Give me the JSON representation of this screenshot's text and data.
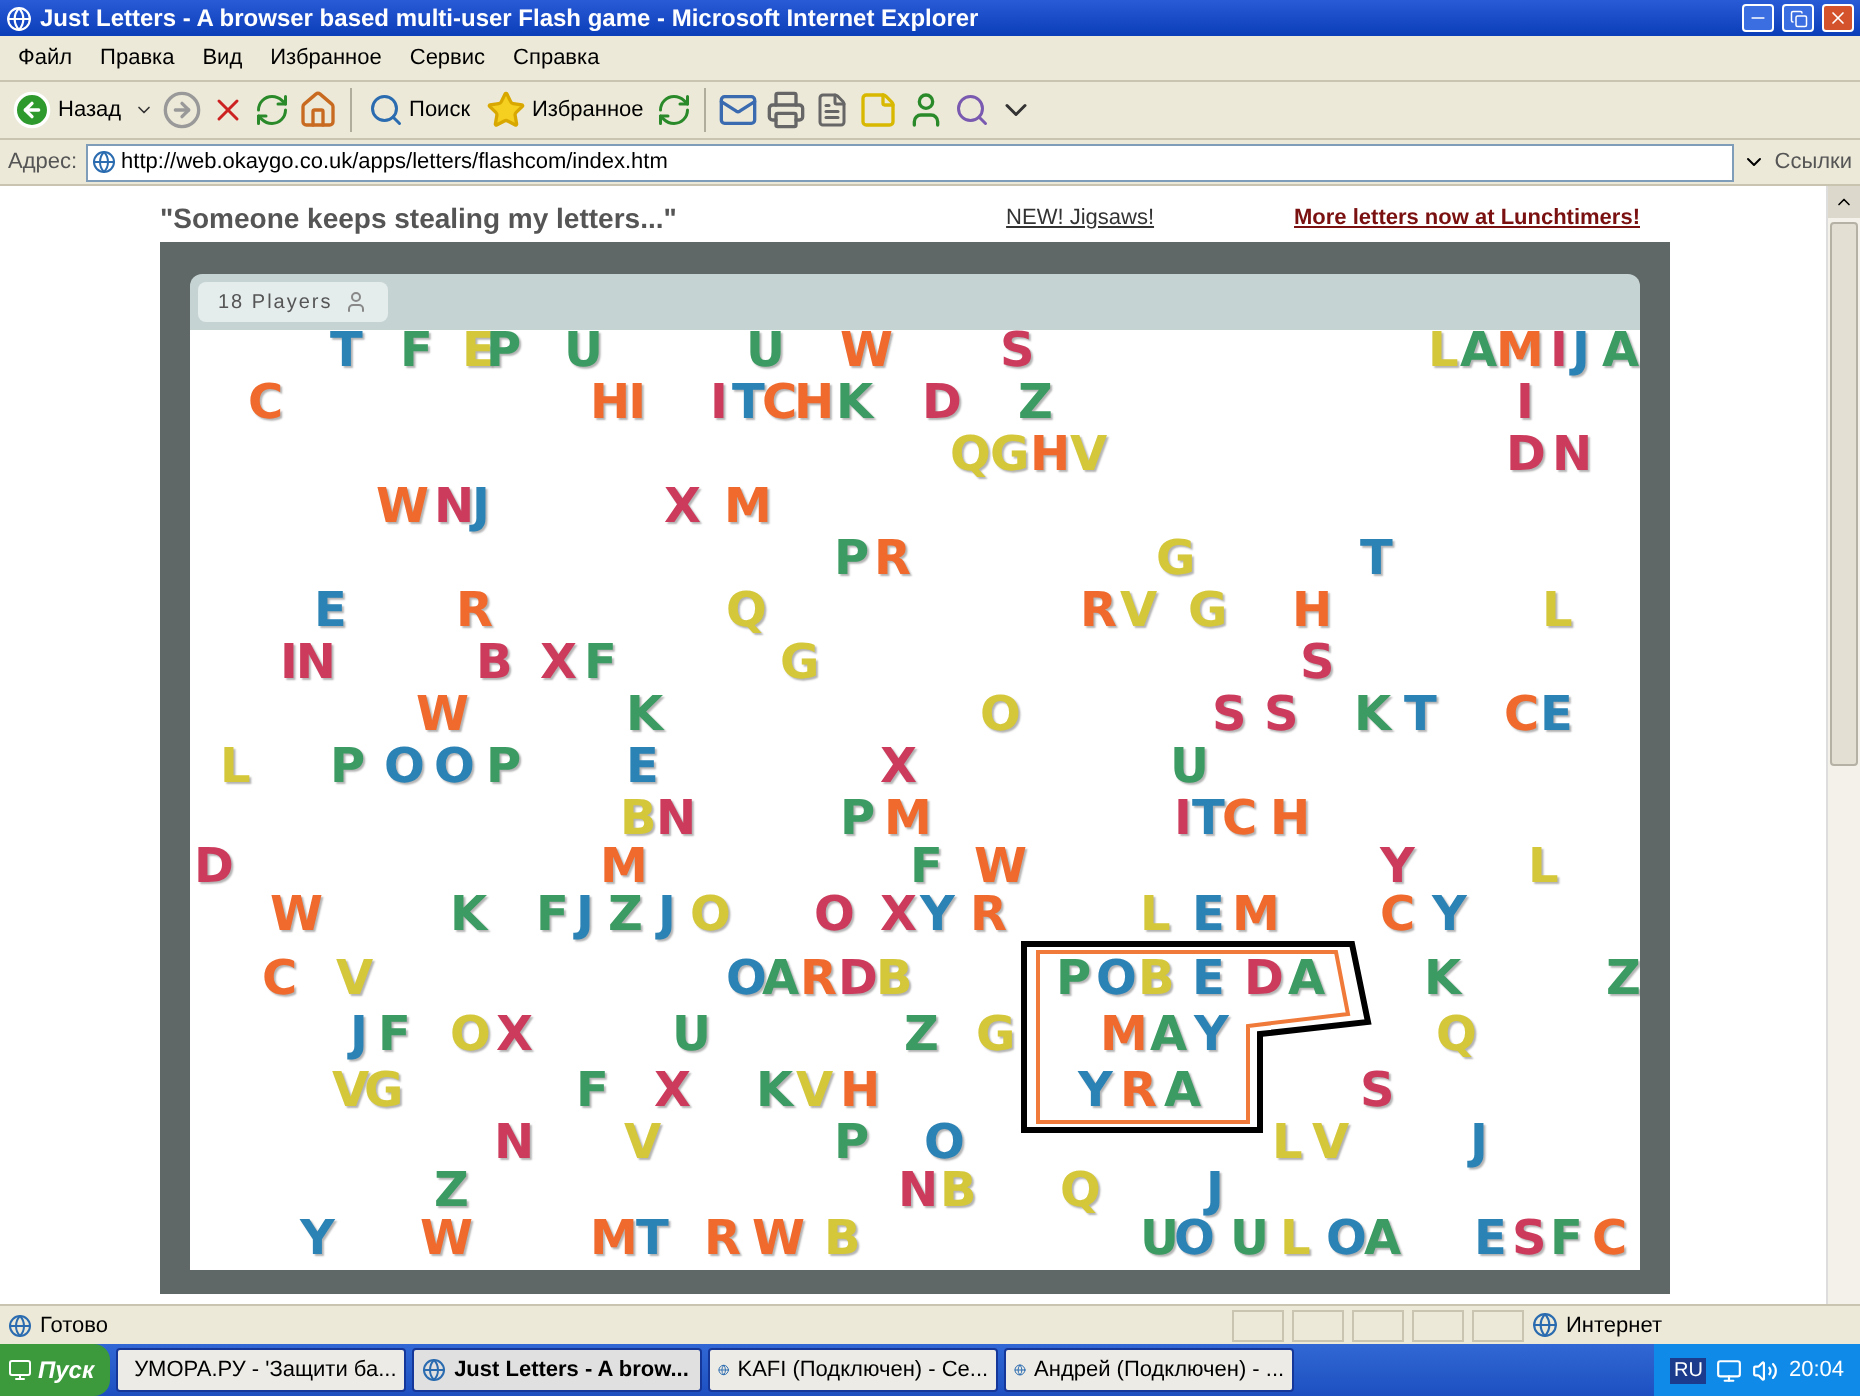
{
  "window": {
    "title": "Just Letters - A browser based multi-user Flash game - Microsoft Internet Explorer"
  },
  "menu": [
    "Файл",
    "Правка",
    "Вид",
    "Избранное",
    "Сервис",
    "Справка"
  ],
  "toolbar": {
    "back": "Назад",
    "search": "Поиск",
    "favorites": "Избранное"
  },
  "address": {
    "label": "Адрес:",
    "value": "http://web.okaygo.co.uk/apps/letters/flashcom/index.htm",
    "links": "Ссылки"
  },
  "page": {
    "tagline": "\"Someone keeps stealing my letters...\"",
    "links": [
      "NEW! Jigsaws!",
      "More letters now at Lunchtimers!"
    ]
  },
  "game": {
    "players": "18 Players",
    "letters": [
      {
        "text": "T",
        "color": "#2b82b5"
      },
      {
        "text": "F",
        "color": "#3b9b62"
      },
      {
        "text": "E",
        "color": "#d4c83a"
      },
      {
        "text": "P",
        "color": "#3b9b62"
      },
      {
        "text": "U",
        "color": "#3b9b62"
      },
      {
        "text": "U",
        "color": "#3b9b62"
      },
      {
        "text": "W",
        "color": "#ef6a2c"
      },
      {
        "text": "S",
        "color": "#cc3b5c"
      },
      {
        "text": "L",
        "color": "#d4c83a"
      },
      {
        "text": "A",
        "color": "#3b9b62"
      },
      {
        "text": "M",
        "color": "#ef6a2c"
      },
      {
        "text": "I",
        "color": "#cc3b5c"
      },
      {
        "text": "J",
        "color": "#2b82b5"
      },
      {
        "text": "A",
        "color": "#3b9b62"
      },
      {
        "text": "C",
        "color": "#ef6a2c"
      },
      {
        "text": "HI",
        "color": "#ef6a2c"
      },
      {
        "text": "I",
        "color": "#cc3b5c"
      },
      {
        "text": "T",
        "color": "#2b82b5"
      },
      {
        "text": "C",
        "color": "#ef6a2c"
      },
      {
        "text": "H",
        "color": "#ef6a2c"
      },
      {
        "text": "K",
        "color": "#3b9b62"
      },
      {
        "text": "D",
        "color": "#cc3b5c"
      },
      {
        "text": "Z",
        "color": "#3b9b62"
      },
      {
        "text": "I",
        "color": "#cc3b5c"
      },
      {
        "text": "Q",
        "color": "#d4c83a"
      },
      {
        "text": "G",
        "color": "#d4c83a"
      },
      {
        "text": "H",
        "color": "#ef6a2c"
      },
      {
        "text": "V",
        "color": "#d4c83a"
      },
      {
        "text": "D",
        "color": "#cc3b5c"
      },
      {
        "text": "N",
        "color": "#cc3b5c"
      },
      {
        "text": "W",
        "color": "#ef6a2c"
      },
      {
        "text": "N",
        "color": "#cc3b5c"
      },
      {
        "text": "J",
        "color": "#2b82b5"
      },
      {
        "text": "X",
        "color": "#cc3b5c"
      },
      {
        "text": "M",
        "color": "#ef6a2c"
      },
      {
        "text": "P",
        "color": "#3b9b62"
      },
      {
        "text": "R",
        "color": "#ef6a2c"
      },
      {
        "text": "G",
        "color": "#d4c83a"
      },
      {
        "text": "T",
        "color": "#2b82b5"
      },
      {
        "text": "E",
        "color": "#2b82b5"
      },
      {
        "text": "R",
        "color": "#ef6a2c"
      },
      {
        "text": "Q",
        "color": "#d4c83a"
      },
      {
        "text": "R",
        "color": "#ef6a2c"
      },
      {
        "text": "V",
        "color": "#d4c83a"
      },
      {
        "text": "G",
        "color": "#d4c83a"
      },
      {
        "text": "H",
        "color": "#ef6a2c"
      },
      {
        "text": "L",
        "color": "#d4c83a"
      },
      {
        "text": "IN",
        "color": "#cc3b5c"
      },
      {
        "text": "B",
        "color": "#cc3b5c"
      },
      {
        "text": "X",
        "color": "#cc3b5c"
      },
      {
        "text": "F",
        "color": "#3b9b62"
      },
      {
        "text": "G",
        "color": "#d4c83a"
      },
      {
        "text": "S",
        "color": "#cc3b5c"
      },
      {
        "text": "W",
        "color": "#ef6a2c"
      },
      {
        "text": "K",
        "color": "#3b9b62"
      },
      {
        "text": "O",
        "color": "#d4c83a"
      },
      {
        "text": "S",
        "color": "#cc3b5c"
      },
      {
        "text": "S",
        "color": "#cc3b5c"
      },
      {
        "text": "K",
        "color": "#3b9b62"
      },
      {
        "text": "T",
        "color": "#2b82b5"
      },
      {
        "text": "C",
        "color": "#ef6a2c"
      },
      {
        "text": "E",
        "color": "#2b82b5"
      },
      {
        "text": "L",
        "color": "#d4c83a"
      },
      {
        "text": "P",
        "color": "#3b9b62"
      },
      {
        "text": "O",
        "color": "#2b82b5"
      },
      {
        "text": "O",
        "color": "#2b82b5"
      },
      {
        "text": "P",
        "color": "#3b9b62"
      },
      {
        "text": "E",
        "color": "#2b82b5"
      },
      {
        "text": "X",
        "color": "#cc3b5c"
      },
      {
        "text": "U",
        "color": "#3b9b62"
      },
      {
        "text": "B",
        "color": "#d4c83a"
      },
      {
        "text": "N",
        "color": "#cc3b5c"
      },
      {
        "text": "P",
        "color": "#3b9b62"
      },
      {
        "text": "M",
        "color": "#ef6a2c"
      },
      {
        "text": "I",
        "color": "#cc3b5c"
      },
      {
        "text": "T",
        "color": "#2b82b5"
      },
      {
        "text": "C",
        "color": "#ef6a2c"
      },
      {
        "text": "H",
        "color": "#ef6a2c"
      },
      {
        "text": "D",
        "color": "#cc3b5c"
      },
      {
        "text": "M",
        "color": "#ef6a2c"
      },
      {
        "text": "F",
        "color": "#3b9b62"
      },
      {
        "text": "W",
        "color": "#ef6a2c"
      },
      {
        "text": "Y",
        "color": "#cc3b5c"
      },
      {
        "text": "L",
        "color": "#d4c83a"
      },
      {
        "text": "W",
        "color": "#ef6a2c"
      },
      {
        "text": "K",
        "color": "#3b9b62"
      },
      {
        "text": "F",
        "color": "#3b9b62"
      },
      {
        "text": "J",
        "color": "#2b82b5"
      },
      {
        "text": "Z",
        "color": "#3b9b62"
      },
      {
        "text": "J",
        "color": "#2b82b5"
      },
      {
        "text": "O",
        "color": "#d4c83a"
      },
      {
        "text": "O",
        "color": "#cc3b5c"
      },
      {
        "text": "X",
        "color": "#cc3b5c"
      },
      {
        "text": "Y",
        "color": "#2b82b5"
      },
      {
        "text": "R",
        "color": "#ef6a2c"
      },
      {
        "text": "L",
        "color": "#d4c83a"
      },
      {
        "text": "E",
        "color": "#2b82b5"
      },
      {
        "text": "M",
        "color": "#ef6a2c"
      },
      {
        "text": "C",
        "color": "#ef6a2c"
      },
      {
        "text": "Y",
        "color": "#2b82b5"
      },
      {
        "text": "C",
        "color": "#ef6a2c"
      },
      {
        "text": "V",
        "color": "#d4c83a"
      },
      {
        "text": "O",
        "color": "#2b82b5"
      },
      {
        "text": "A",
        "color": "#3b9b62"
      },
      {
        "text": "R",
        "color": "#ef6a2c"
      },
      {
        "text": "D",
        "color": "#cc3b5c"
      },
      {
        "text": "B",
        "color": "#d4c83a"
      },
      {
        "text": "P",
        "color": "#3b9b62"
      },
      {
        "text": "O",
        "color": "#2b82b5"
      },
      {
        "text": "B",
        "color": "#d4c83a"
      },
      {
        "text": "E",
        "color": "#2b82b5"
      },
      {
        "text": "D",
        "color": "#cc3b5c"
      },
      {
        "text": "A",
        "color": "#3b9b62"
      },
      {
        "text": "K",
        "color": "#3b9b62"
      },
      {
        "text": "Z",
        "color": "#3b9b62"
      },
      {
        "text": "J",
        "color": "#2b82b5"
      },
      {
        "text": "F",
        "color": "#3b9b62"
      },
      {
        "text": "O",
        "color": "#d4c83a"
      },
      {
        "text": "X",
        "color": "#cc3b5c"
      },
      {
        "text": "U",
        "color": "#3b9b62"
      },
      {
        "text": "Z",
        "color": "#3b9b62"
      },
      {
        "text": "G",
        "color": "#d4c83a"
      },
      {
        "text": "M",
        "color": "#ef6a2c"
      },
      {
        "text": "A",
        "color": "#3b9b62"
      },
      {
        "text": "Y",
        "color": "#2b82b5"
      },
      {
        "text": "Q",
        "color": "#d4c83a"
      },
      {
        "text": "V",
        "color": "#d4c83a"
      },
      {
        "text": "G",
        "color": "#d4c83a"
      },
      {
        "text": "F",
        "color": "#3b9b62"
      },
      {
        "text": "X",
        "color": "#cc3b5c"
      },
      {
        "text": "K",
        "color": "#3b9b62"
      },
      {
        "text": "V",
        "color": "#d4c83a"
      },
      {
        "text": "H",
        "color": "#ef6a2c"
      },
      {
        "text": "Y",
        "color": "#2b82b5"
      },
      {
        "text": "R",
        "color": "#ef6a2c"
      },
      {
        "text": "A",
        "color": "#3b9b62"
      },
      {
        "text": "S",
        "color": "#cc3b5c"
      },
      {
        "text": "N",
        "color": "#cc3b5c"
      },
      {
        "text": "V",
        "color": "#d4c83a"
      },
      {
        "text": "P",
        "color": "#3b9b62"
      },
      {
        "text": "O",
        "color": "#2b82b5"
      },
      {
        "text": "L",
        "color": "#d4c83a"
      },
      {
        "text": "V",
        "color": "#d4c83a"
      },
      {
        "text": "J",
        "color": "#2b82b5"
      },
      {
        "text": "Z",
        "color": "#3b9b62"
      },
      {
        "text": "N",
        "color": "#cc3b5c"
      },
      {
        "text": "B",
        "color": "#d4c83a"
      },
      {
        "text": "Q",
        "color": "#d4c83a"
      },
      {
        "text": "J",
        "color": "#2b82b5"
      },
      {
        "text": "Y",
        "color": "#2b82b5"
      },
      {
        "text": "W",
        "color": "#ef6a2c"
      },
      {
        "text": "M",
        "color": "#ef6a2c"
      },
      {
        "text": "T",
        "color": "#2b82b5"
      },
      {
        "text": "R",
        "color": "#ef6a2c"
      },
      {
        "text": "W",
        "color": "#ef6a2c"
      },
      {
        "text": "B",
        "color": "#d4c83a"
      },
      {
        "text": "U",
        "color": "#3b9b62"
      },
      {
        "text": "O",
        "color": "#2b82b5"
      },
      {
        "text": "U",
        "color": "#3b9b62"
      },
      {
        "text": "L",
        "color": "#d4c83a"
      },
      {
        "text": "O",
        "color": "#2b82b5"
      },
      {
        "text": "A",
        "color": "#3b9b62"
      },
      {
        "text": "E",
        "color": "#2b82b5"
      },
      {
        "text": "S",
        "color": "#cc3b5c"
      },
      {
        "text": "F",
        "color": "#3b9b62"
      },
      {
        "text": "C",
        "color": "#ef6a2c"
      }
    ]
  },
  "status_bar": {
    "text": "Готово",
    "zone": "Интернет"
  },
  "taskbar": {
    "start": "Пуск",
    "tasks": [
      {
        "label": "УМОРА.РУ - 'Защити ба...",
        "selected": false
      },
      {
        "label": "Just Letters - A brow...",
        "selected": true
      },
      {
        "label": "KAFI (Подключен) - Се...",
        "selected": false
      },
      {
        "label": "Андрей (Подключен) - ...",
        "selected": false
      }
    ],
    "language": "RU",
    "clock": "20:04"
  }
}
